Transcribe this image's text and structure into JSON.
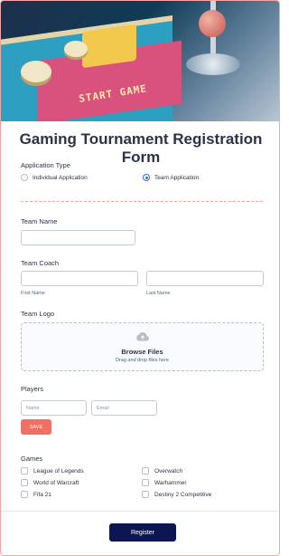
{
  "form": {
    "title": "Gaming Tournament Registration Form",
    "hero_text": "START GAME"
  },
  "application_type": {
    "label": "Application Type",
    "options": [
      {
        "label": "Individual Application",
        "selected": false
      },
      {
        "label": "Team Application",
        "selected": true
      }
    ]
  },
  "team_name": {
    "label": "Team Name",
    "value": ""
  },
  "team_coach": {
    "label": "Team Coach",
    "first_sublabel": "First Name",
    "last_sublabel": "Last Name",
    "first_value": "",
    "last_value": ""
  },
  "team_logo": {
    "label": "Team Logo",
    "browse_label": "Browse Files",
    "drag_text": "Drag and drop files here",
    "icon": "cloud-upload-icon"
  },
  "players": {
    "label": "Players",
    "name_placeholder": "Name",
    "email_placeholder": "Email",
    "save_label": "SAVE"
  },
  "games": {
    "label": "Games",
    "options": [
      "League of Legends",
      "Overwatch",
      "World of Warcraft",
      "Warhammer",
      "Fifa 21",
      "Destiny 2 Competitive"
    ]
  },
  "submit": {
    "label": "Register"
  },
  "colors": {
    "accent": "#f26f63",
    "primary": "#0a1551",
    "radio_selected": "#2e69ff",
    "border": "#f2a7a4"
  }
}
